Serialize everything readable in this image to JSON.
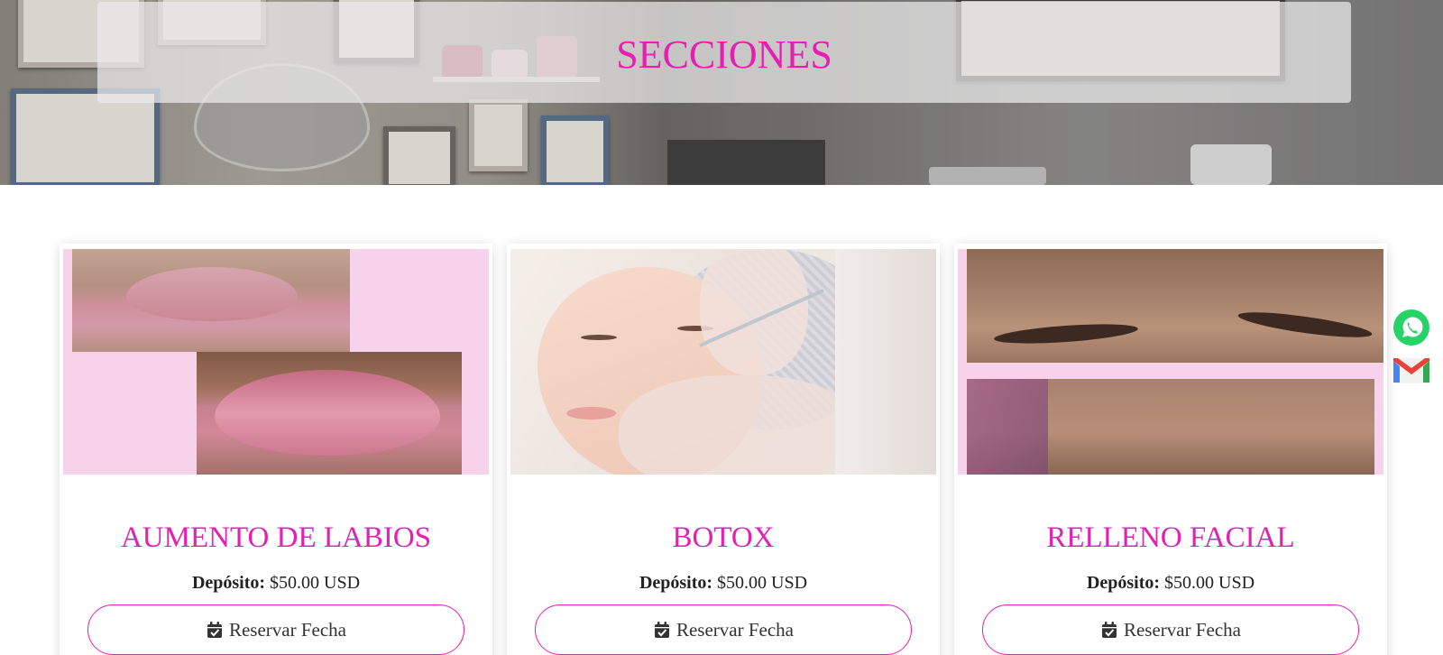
{
  "hero": {
    "title": "SECCIONES"
  },
  "cards": [
    {
      "title": "AUMENTO DE LABIOS",
      "deposit_label": "Depósito:",
      "deposit_value": "$50.00 USD",
      "button_label": "Reservar Fecha",
      "button_icon": "calendar-check-icon"
    },
    {
      "title": "BOTOX",
      "deposit_label": "Depósito:",
      "deposit_value": "$50.00 USD",
      "button_label": "Reservar Fecha",
      "button_icon": "calendar-check-icon"
    },
    {
      "title": "RELLENO FACIAL",
      "deposit_label": "Depósito:",
      "deposit_value": "$50.00 USD",
      "button_label": "Reservar Fecha",
      "button_icon": "calendar-check-icon"
    }
  ],
  "floating": {
    "icons": [
      "whatsapp-icon",
      "gmail-icon"
    ]
  },
  "colors": {
    "accent": "#e51fb2",
    "pink_bg": "#f6d3ea",
    "whatsapp": "#25d366"
  }
}
